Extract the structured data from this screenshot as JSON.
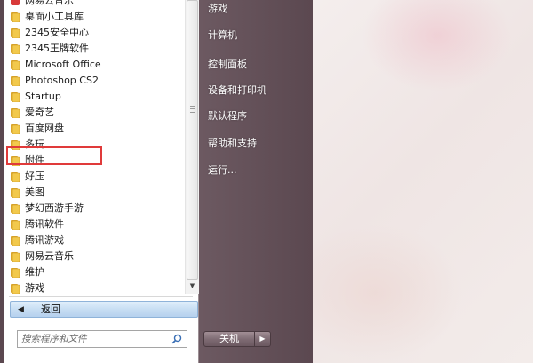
{
  "programs": [
    {
      "label": "网易云音乐",
      "icon": "app-icon"
    },
    {
      "label": "桌面小工具库",
      "icon": "folder-icon"
    },
    {
      "label": "2345安全中心",
      "icon": "folder-icon"
    },
    {
      "label": "2345王牌软件",
      "icon": "folder-icon"
    },
    {
      "label": "Microsoft Office",
      "icon": "folder-icon"
    },
    {
      "label": "Photoshop CS2",
      "icon": "folder-icon"
    },
    {
      "label": "Startup",
      "icon": "folder-icon"
    },
    {
      "label": "爱奇艺",
      "icon": "folder-icon"
    },
    {
      "label": "百度网盘",
      "icon": "folder-icon"
    },
    {
      "label": "多玩",
      "icon": "folder-icon"
    },
    {
      "label": "附件",
      "icon": "folder-icon"
    },
    {
      "label": "好压",
      "icon": "folder-icon"
    },
    {
      "label": "美图",
      "icon": "folder-icon"
    },
    {
      "label": "梦幻西游手游",
      "icon": "folder-icon"
    },
    {
      "label": "腾讯软件",
      "icon": "folder-icon"
    },
    {
      "label": "腾讯游戏",
      "icon": "folder-icon"
    },
    {
      "label": "网易云音乐",
      "icon": "folder-icon"
    },
    {
      "label": "维护",
      "icon": "folder-icon"
    },
    {
      "label": "游戏",
      "icon": "folder-icon"
    }
  ],
  "back_button": {
    "label": "返回"
  },
  "search": {
    "placeholder": "搜索程序和文件"
  },
  "right_pane": {
    "items": [
      "游戏",
      "计算机",
      "控制面板",
      "设备和打印机",
      "默认程序",
      "帮助和支持",
      "运行..."
    ]
  },
  "shutdown": {
    "label": "关机"
  },
  "colors": {
    "highlight_border": "#e03a3a",
    "menu_background": "#6e5b63",
    "folder_yellow": "#e8b93a"
  }
}
